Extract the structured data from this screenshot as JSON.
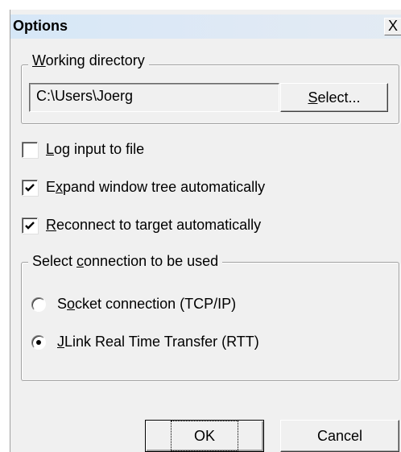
{
  "dialog": {
    "title": "Options",
    "close_glyph": "X"
  },
  "working_directory": {
    "label_mnemonic": "W",
    "label_rest": "orking directory",
    "path_value": "C:\\Users\\Joerg",
    "select_mnemonic": "S",
    "select_rest": "elect..."
  },
  "options": {
    "log_input": {
      "pre": "",
      "mnemonic": "L",
      "post": "og input to file",
      "checked": false
    },
    "expand_tree": {
      "pre": "E",
      "mnemonic": "x",
      "post": "pand window tree automatically",
      "checked": true
    },
    "reconnect": {
      "pre": "",
      "mnemonic": "R",
      "post": "econnect to target automatically",
      "checked": true
    }
  },
  "connection": {
    "label_pre": "Select ",
    "label_mnemonic": "c",
    "label_post": "onnection to be used",
    "socket": {
      "pre": "S",
      "mnemonic": "o",
      "post": "cket connection (TCP/IP)",
      "selected": false
    },
    "rtt": {
      "pre": "",
      "mnemonic": "J",
      "post": "Link Real Time Transfer (RTT)",
      "selected": true
    }
  },
  "buttons": {
    "ok": "OK",
    "cancel": "Cancel"
  },
  "icons": [
    "close-icon",
    "checkmark-icon",
    "radio-dot-icon"
  ]
}
